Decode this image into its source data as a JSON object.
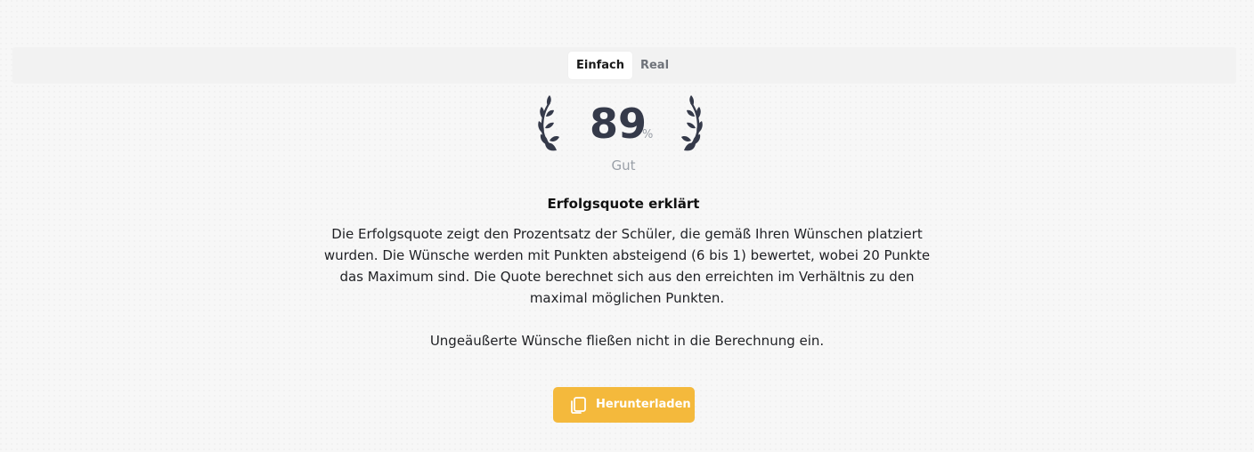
{
  "tabs": [
    {
      "label": "Einfach",
      "active": true
    },
    {
      "label": "Real",
      "active": false
    }
  ],
  "score": {
    "value": "89",
    "unit": "%",
    "rating": "Gut"
  },
  "explanation": {
    "title": "Erfolgsquote erklärt",
    "paragraph1": "Die Erfolgsquote zeigt den Prozentsatz der Schüler, die gemäß Ihren Wünschen platziert wurden. Die Wünsche werden mit Punkten absteigend (6 bis 1) bewertet, wobei 20 Punkte das Maximum sind. Die Quote berechnet sich aus den erreichten im Verhältnis zu den maximal möglichen Punkten.",
    "paragraph2": "Ungeäußerte Wünsche fließen nicht in die Berechnung ein."
  },
  "download": {
    "label": "Herunterladen",
    "icon": "copy-icon",
    "color": "#f4b93c"
  },
  "colors": {
    "score": "#353a4a",
    "muted": "#9aa0a8"
  }
}
